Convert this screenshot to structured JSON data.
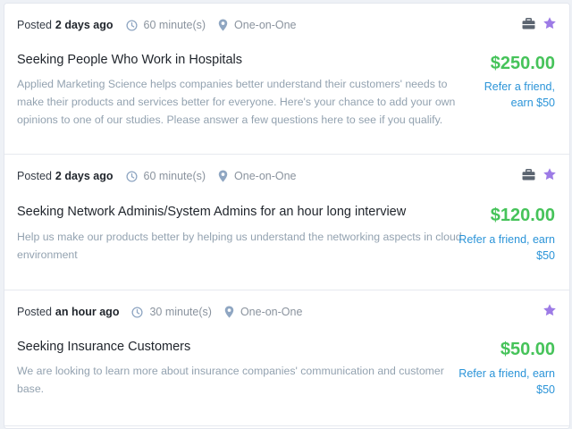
{
  "colors": {
    "price": "#46c35a",
    "link": "#2b94d8",
    "star": "#9d7be6",
    "muted_icon": "#8fa6c2",
    "briefcase": "#5b6470"
  },
  "icons": [
    "clock-icon",
    "pin-icon",
    "briefcase-icon",
    "star-icon"
  ],
  "studies": [
    {
      "posted_label": "Posted",
      "posted_when": "2 days ago",
      "duration": "60 minute(s)",
      "format": "One-on-One",
      "title": "Seeking People Who Work in Hospitals",
      "description": "Applied Marketing Science helps companies better understand their customers' needs to make their products and services better for everyone. Here's your chance to add your own opinions to one of our studies. Please answer a few questions here to see if you qualify.",
      "price": "$250.00",
      "refer_line1": "Refer a friend,",
      "refer_line2": "earn $50"
    },
    {
      "posted_label": "Posted",
      "posted_when": "2 days ago",
      "duration": "60 minute(s)",
      "format": "One-on-One",
      "title": "Seeking Network Adminis/System Admins for an hour long interview",
      "description": "Help us make our products better by helping us understand the networking aspects in cloud environment",
      "price": "$120.00",
      "refer_line1": "Refer a friend, earn",
      "refer_line2": "$50"
    },
    {
      "posted_label": "Posted",
      "posted_when": "an hour ago",
      "duration": "30 minute(s)",
      "format": "One-on-One",
      "title": "Seeking Insurance Customers",
      "description": "We are looking to learn more about insurance companies' communication and customer base.",
      "price": "$50.00",
      "refer_line1": "Refer a friend, earn",
      "refer_line2": "$50"
    }
  ]
}
